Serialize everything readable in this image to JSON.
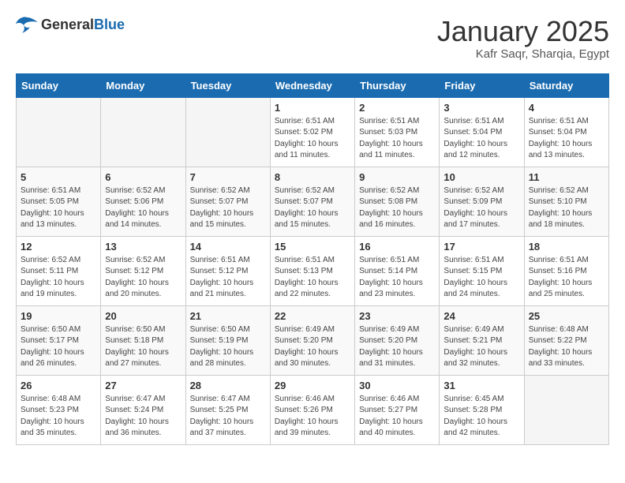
{
  "header": {
    "logo_general": "General",
    "logo_blue": "Blue",
    "title": "January 2025",
    "subtitle": "Kafr Saqr, Sharqia, Egypt"
  },
  "days_of_week": [
    "Sunday",
    "Monday",
    "Tuesday",
    "Wednesday",
    "Thursday",
    "Friday",
    "Saturday"
  ],
  "weeks": [
    [
      {
        "num": "",
        "info": "",
        "empty": true
      },
      {
        "num": "",
        "info": "",
        "empty": true
      },
      {
        "num": "",
        "info": "",
        "empty": true
      },
      {
        "num": "1",
        "info": "Sunrise: 6:51 AM\nSunset: 5:02 PM\nDaylight: 10 hours\nand 11 minutes.",
        "empty": false
      },
      {
        "num": "2",
        "info": "Sunrise: 6:51 AM\nSunset: 5:03 PM\nDaylight: 10 hours\nand 11 minutes.",
        "empty": false
      },
      {
        "num": "3",
        "info": "Sunrise: 6:51 AM\nSunset: 5:04 PM\nDaylight: 10 hours\nand 12 minutes.",
        "empty": false
      },
      {
        "num": "4",
        "info": "Sunrise: 6:51 AM\nSunset: 5:04 PM\nDaylight: 10 hours\nand 13 minutes.",
        "empty": false
      }
    ],
    [
      {
        "num": "5",
        "info": "Sunrise: 6:51 AM\nSunset: 5:05 PM\nDaylight: 10 hours\nand 13 minutes.",
        "empty": false
      },
      {
        "num": "6",
        "info": "Sunrise: 6:52 AM\nSunset: 5:06 PM\nDaylight: 10 hours\nand 14 minutes.",
        "empty": false
      },
      {
        "num": "7",
        "info": "Sunrise: 6:52 AM\nSunset: 5:07 PM\nDaylight: 10 hours\nand 15 minutes.",
        "empty": false
      },
      {
        "num": "8",
        "info": "Sunrise: 6:52 AM\nSunset: 5:07 PM\nDaylight: 10 hours\nand 15 minutes.",
        "empty": false
      },
      {
        "num": "9",
        "info": "Sunrise: 6:52 AM\nSunset: 5:08 PM\nDaylight: 10 hours\nand 16 minutes.",
        "empty": false
      },
      {
        "num": "10",
        "info": "Sunrise: 6:52 AM\nSunset: 5:09 PM\nDaylight: 10 hours\nand 17 minutes.",
        "empty": false
      },
      {
        "num": "11",
        "info": "Sunrise: 6:52 AM\nSunset: 5:10 PM\nDaylight: 10 hours\nand 18 minutes.",
        "empty": false
      }
    ],
    [
      {
        "num": "12",
        "info": "Sunrise: 6:52 AM\nSunset: 5:11 PM\nDaylight: 10 hours\nand 19 minutes.",
        "empty": false
      },
      {
        "num": "13",
        "info": "Sunrise: 6:52 AM\nSunset: 5:12 PM\nDaylight: 10 hours\nand 20 minutes.",
        "empty": false
      },
      {
        "num": "14",
        "info": "Sunrise: 6:51 AM\nSunset: 5:12 PM\nDaylight: 10 hours\nand 21 minutes.",
        "empty": false
      },
      {
        "num": "15",
        "info": "Sunrise: 6:51 AM\nSunset: 5:13 PM\nDaylight: 10 hours\nand 22 minutes.",
        "empty": false
      },
      {
        "num": "16",
        "info": "Sunrise: 6:51 AM\nSunset: 5:14 PM\nDaylight: 10 hours\nand 23 minutes.",
        "empty": false
      },
      {
        "num": "17",
        "info": "Sunrise: 6:51 AM\nSunset: 5:15 PM\nDaylight: 10 hours\nand 24 minutes.",
        "empty": false
      },
      {
        "num": "18",
        "info": "Sunrise: 6:51 AM\nSunset: 5:16 PM\nDaylight: 10 hours\nand 25 minutes.",
        "empty": false
      }
    ],
    [
      {
        "num": "19",
        "info": "Sunrise: 6:50 AM\nSunset: 5:17 PM\nDaylight: 10 hours\nand 26 minutes.",
        "empty": false
      },
      {
        "num": "20",
        "info": "Sunrise: 6:50 AM\nSunset: 5:18 PM\nDaylight: 10 hours\nand 27 minutes.",
        "empty": false
      },
      {
        "num": "21",
        "info": "Sunrise: 6:50 AM\nSunset: 5:19 PM\nDaylight: 10 hours\nand 28 minutes.",
        "empty": false
      },
      {
        "num": "22",
        "info": "Sunrise: 6:49 AM\nSunset: 5:20 PM\nDaylight: 10 hours\nand 30 minutes.",
        "empty": false
      },
      {
        "num": "23",
        "info": "Sunrise: 6:49 AM\nSunset: 5:20 PM\nDaylight: 10 hours\nand 31 minutes.",
        "empty": false
      },
      {
        "num": "24",
        "info": "Sunrise: 6:49 AM\nSunset: 5:21 PM\nDaylight: 10 hours\nand 32 minutes.",
        "empty": false
      },
      {
        "num": "25",
        "info": "Sunrise: 6:48 AM\nSunset: 5:22 PM\nDaylight: 10 hours\nand 33 minutes.",
        "empty": false
      }
    ],
    [
      {
        "num": "26",
        "info": "Sunrise: 6:48 AM\nSunset: 5:23 PM\nDaylight: 10 hours\nand 35 minutes.",
        "empty": false
      },
      {
        "num": "27",
        "info": "Sunrise: 6:47 AM\nSunset: 5:24 PM\nDaylight: 10 hours\nand 36 minutes.",
        "empty": false
      },
      {
        "num": "28",
        "info": "Sunrise: 6:47 AM\nSunset: 5:25 PM\nDaylight: 10 hours\nand 37 minutes.",
        "empty": false
      },
      {
        "num": "29",
        "info": "Sunrise: 6:46 AM\nSunset: 5:26 PM\nDaylight: 10 hours\nand 39 minutes.",
        "empty": false
      },
      {
        "num": "30",
        "info": "Sunrise: 6:46 AM\nSunset: 5:27 PM\nDaylight: 10 hours\nand 40 minutes.",
        "empty": false
      },
      {
        "num": "31",
        "info": "Sunrise: 6:45 AM\nSunset: 5:28 PM\nDaylight: 10 hours\nand 42 minutes.",
        "empty": false
      },
      {
        "num": "",
        "info": "",
        "empty": true
      }
    ]
  ]
}
